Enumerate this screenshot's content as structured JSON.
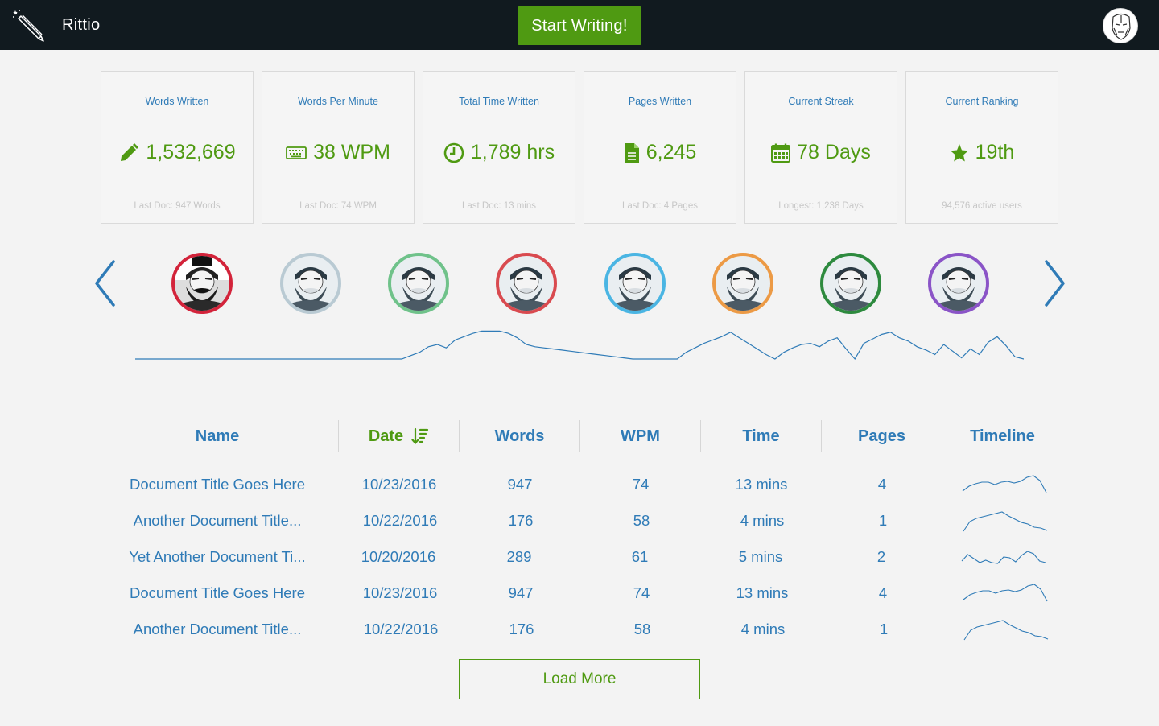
{
  "app": {
    "name": "Rittio",
    "start_label": "Start Writing!"
  },
  "colors": {
    "accent": "#4f9a12",
    "link": "#2f7bb7",
    "topbar": "#111a1f"
  },
  "stats": [
    {
      "title": "Words Written",
      "value": "1,532,669",
      "sub": "Last Doc: 947 Words",
      "icon": "pencil-icon"
    },
    {
      "title": "Words Per Minute",
      "value": "38 WPM",
      "sub": "Last Doc: 74 WPM",
      "icon": "keyboard-icon"
    },
    {
      "title": "Total Time Written",
      "value": "1,789 hrs",
      "sub": "Last Doc: 13 mins",
      "icon": "clock-icon"
    },
    {
      "title": "Pages Written",
      "value": "6,245",
      "sub": "Last Doc: 4 Pages",
      "icon": "document-icon"
    },
    {
      "title": "Current Streak",
      "value": "78 Days",
      "sub": "Longest: 1,238 Days",
      "icon": "calendar-icon"
    },
    {
      "title": "Current Ranking",
      "value": "19th",
      "sub": "94,576 active users",
      "icon": "star-icon"
    }
  ],
  "carousel": {
    "avatars": [
      {
        "ring": "#d3233a",
        "variant": "dark"
      },
      {
        "ring": "#b9cad3",
        "variant": "light"
      },
      {
        "ring": "#6fc28a",
        "variant": "light"
      },
      {
        "ring": "#d94a4f",
        "variant": "light"
      },
      {
        "ring": "#4ab5e3",
        "variant": "light"
      },
      {
        "ring": "#ec9a45",
        "variant": "light"
      },
      {
        "ring": "#2d8a3e",
        "variant": "light"
      },
      {
        "ring": "#8a54c7",
        "variant": "light"
      }
    ]
  },
  "activity": [
    0,
    0,
    0,
    0,
    0,
    0,
    0,
    0,
    0,
    0,
    0,
    0,
    0,
    0,
    0,
    0,
    0,
    0,
    0,
    0,
    0,
    0,
    0,
    0,
    0,
    0,
    0,
    0,
    0,
    0,
    0,
    3,
    6,
    11,
    13,
    10,
    17,
    20,
    23,
    25,
    25,
    25,
    23,
    19,
    13,
    11,
    10,
    9,
    8,
    7,
    6,
    5,
    4,
    3,
    2,
    1,
    0,
    0,
    0,
    0,
    0,
    0,
    6,
    10,
    14,
    17,
    20,
    24,
    19,
    14,
    9,
    4,
    0,
    6,
    10,
    13,
    14,
    11,
    16,
    19,
    9,
    0,
    14,
    18,
    22,
    24,
    19,
    16,
    11,
    8,
    4,
    13,
    7,
    1,
    9,
    4,
    15,
    20,
    12,
    2,
    0
  ],
  "table": {
    "headers": {
      "name": "Name",
      "date": "Date",
      "words": "Words",
      "wpm": "WPM",
      "time": "Time",
      "pages": "Pages",
      "timeline": "Timeline"
    },
    "rows": [
      {
        "name": "Document Title Goes Here",
        "date": "10/23/2016",
        "words": "947",
        "wpm": "74",
        "time": "13 mins",
        "pages": "4",
        "timeline": [
          5,
          11,
          14,
          16,
          16,
          13,
          16,
          17,
          15,
          17,
          22,
          24,
          18,
          3
        ]
      },
      {
        "name": "Another Document Title...",
        "date": "10/22/2016",
        "words": "176",
        "wpm": "58",
        "time": "4 mins",
        "pages": "1",
        "timeline": [
          0,
          12,
          16,
          18,
          20,
          22,
          24,
          19,
          15,
          11,
          9,
          5,
          4,
          1
        ]
      },
      {
        "name": "Yet Another Document Ti...",
        "date": "10/20/2016",
        "words": "289",
        "wpm": "61",
        "time": "5 mins",
        "pages": "2",
        "timeline": [
          8,
          16,
          11,
          6,
          9,
          6,
          5,
          13,
          12,
          7,
          15,
          20,
          17,
          8,
          6
        ]
      },
      {
        "name": "Document Title Goes Here",
        "date": "10/23/2016",
        "words": "947",
        "wpm": "74",
        "time": "13 mins",
        "pages": "4",
        "timeline": [
          5,
          11,
          14,
          16,
          16,
          13,
          16,
          17,
          15,
          17,
          22,
          24,
          18,
          3
        ]
      },
      {
        "name": "Another Document Title...",
        "date": "10/22/2016",
        "words": "176",
        "wpm": "58",
        "time": "4 mins",
        "pages": "1",
        "timeline": [
          0,
          12,
          16,
          18,
          20,
          22,
          24,
          19,
          15,
          11,
          9,
          5,
          4,
          1
        ]
      }
    ]
  },
  "load_more_label": "Load More"
}
